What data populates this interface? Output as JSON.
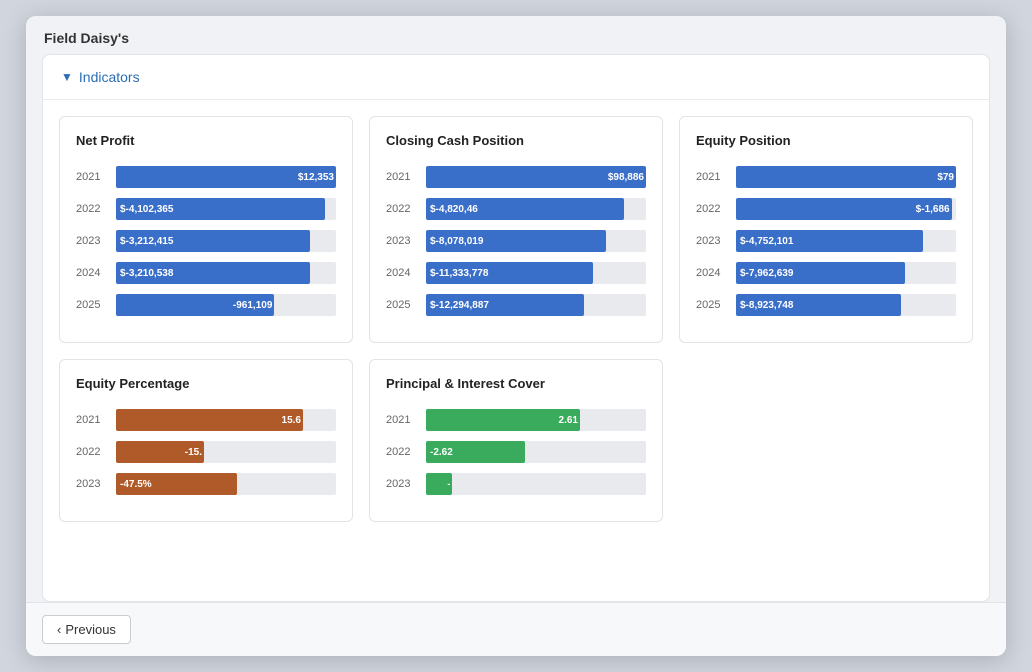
{
  "window": {
    "title": "Field Daisy's"
  },
  "indicators": {
    "label": "Indicators",
    "toggle": "chevron-down"
  },
  "cards": {
    "net_profit": {
      "title": "Net Profit",
      "rows": [
        {
          "year": "2021",
          "value_label": "$12,353",
          "pct": 100,
          "type": "blue"
        },
        {
          "year": "2022",
          "value_label": "$-4,102,365",
          "pct": 95,
          "type": "blue"
        },
        {
          "year": "2023",
          "value_label": "$-3,212,415",
          "pct": 88,
          "type": "blue"
        },
        {
          "year": "2024",
          "value_label": "$-3,210,538",
          "pct": 88,
          "type": "blue"
        },
        {
          "year": "2025",
          "value_label": "-961,109",
          "pct": 72,
          "type": "blue"
        }
      ]
    },
    "closing_cash": {
      "title": "Closing Cash Position",
      "rows": [
        {
          "year": "2021",
          "value_label": "$98,886",
          "pct": 100,
          "type": "blue"
        },
        {
          "year": "2022",
          "value_label": "$-4,820,46",
          "pct": 90,
          "type": "blue"
        },
        {
          "year": "2023",
          "value_label": "$-8,078,019",
          "pct": 82,
          "type": "blue"
        },
        {
          "year": "2024",
          "value_label": "$-11,333,778",
          "pct": 75,
          "type": "blue"
        },
        {
          "year": "2025",
          "value_label": "$-12,294,887",
          "pct": 72,
          "type": "blue"
        }
      ]
    },
    "equity_position": {
      "title": "Equity Position",
      "rows": [
        {
          "year": "2021",
          "value_label": "$79",
          "pct": 100,
          "type": "blue"
        },
        {
          "year": "2022",
          "value_label": "$-1,686",
          "pct": 98,
          "type": "blue"
        },
        {
          "year": "2023",
          "value_label": "$-4,752,101",
          "pct": 85,
          "type": "blue"
        },
        {
          "year": "2024",
          "value_label": "$-7,962,639",
          "pct": 77,
          "type": "blue"
        },
        {
          "year": "2025",
          "value_label": "$-8,923,748",
          "pct": 75,
          "type": "blue"
        }
      ]
    },
    "equity_percentage": {
      "title": "Equity Percentage",
      "rows": [
        {
          "year": "2021",
          "value_label": "15.6",
          "pct": 85,
          "type": "brown"
        },
        {
          "year": "2022",
          "value_label": "-15.",
          "pct": 40,
          "type": "brown"
        },
        {
          "year": "2023",
          "value_label": "-47.5%",
          "pct": 55,
          "type": "brown"
        }
      ]
    },
    "principal_interest": {
      "title": "Principal & Interest Cover",
      "rows": [
        {
          "year": "2021",
          "value_label": "2.61",
          "pct": 70,
          "type": "green"
        },
        {
          "year": "2022",
          "value_label": "-2.62",
          "pct": 45,
          "type": "green"
        },
        {
          "year": "2023",
          "value_label": "-",
          "pct": 12,
          "type": "gray"
        }
      ]
    }
  },
  "footer": {
    "previous_label": "Previous"
  }
}
